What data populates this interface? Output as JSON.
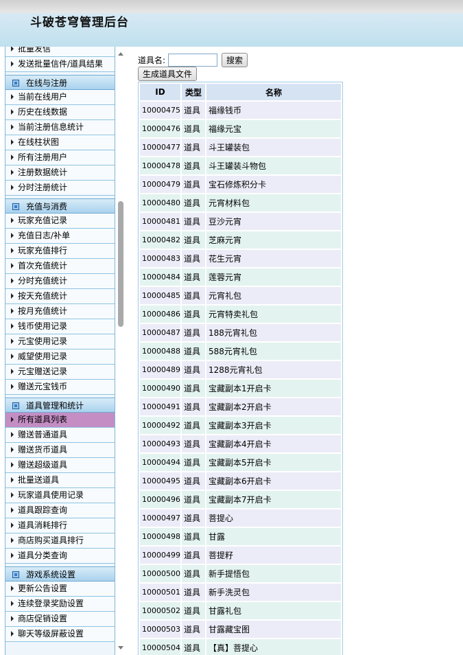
{
  "header": {
    "title": "斗破苍穹管理后台"
  },
  "sidebar": {
    "groups": [
      {
        "title": "",
        "items": [
          "批量发信",
          "发送批量信件/道具结果"
        ]
      },
      {
        "title": "在线与注册",
        "items": [
          "当前在线用户",
          "历史在线数据",
          "当前注册信息统计",
          "在线柱状图",
          "所有注册用户",
          "注册数据统计",
          "分时注册统计"
        ]
      },
      {
        "title": "充值与消费",
        "items": [
          "玩家充值记录",
          "充值日志/补单",
          "玩家充值排行",
          "首次充值统计",
          "分时充值统计",
          "按天充值统计",
          "按月充值统计",
          "钱币使用记录",
          "元宝使用记录",
          "威望使用记录",
          "元宝赠送记录",
          "赠送元宝钱币"
        ]
      },
      {
        "title": "道具管理和统计",
        "items": [
          "所有道具列表",
          "赠送普通道具",
          "赠送货币道具",
          "赠送超级道具",
          "批量送道具",
          "玩家道具使用记录",
          "道具跟踪查询",
          "道具消耗排行",
          "商店购买道具排行",
          "道具分类查询"
        ]
      },
      {
        "title": "游戏系统设置",
        "items": [
          "更新公告设置",
          "连续登录奖励设置",
          "商店促销设置",
          "聊天等级屏蔽设置"
        ]
      }
    ],
    "active_item": "所有道具列表"
  },
  "search": {
    "label": "道具名:",
    "value": "",
    "button": "搜索",
    "generate_button": "生成道具文件"
  },
  "table": {
    "columns": [
      "ID",
      "类型",
      "名称"
    ],
    "rows": [
      [
        "10000475",
        "道具",
        "福缘钱币"
      ],
      [
        "10000476",
        "道具",
        "福缘元宝"
      ],
      [
        "10000477",
        "道具",
        "斗王罐装包"
      ],
      [
        "10000478",
        "道具",
        "斗王罐装斗物包"
      ],
      [
        "10000479",
        "道具",
        "宝石修炼积分卡"
      ],
      [
        "10000480",
        "道具",
        "元宵材料包"
      ],
      [
        "10000481",
        "道具",
        "豆沙元宵"
      ],
      [
        "10000482",
        "道具",
        "芝麻元宵"
      ],
      [
        "10000483",
        "道具",
        "花生元宵"
      ],
      [
        "10000484",
        "道具",
        "莲蓉元宵"
      ],
      [
        "10000485",
        "道具",
        "元宵礼包"
      ],
      [
        "10000486",
        "道具",
        "元宵特卖礼包"
      ],
      [
        "10000487",
        "道具",
        "188元宵礼包"
      ],
      [
        "10000488",
        "道具",
        "588元宵礼包"
      ],
      [
        "10000489",
        "道具",
        "1288元宵礼包"
      ],
      [
        "10000490",
        "道具",
        "宝藏副本1开启卡"
      ],
      [
        "10000491",
        "道具",
        "宝藏副本2开启卡"
      ],
      [
        "10000492",
        "道具",
        "宝藏副本3开启卡"
      ],
      [
        "10000493",
        "道具",
        "宝藏副本4开启卡"
      ],
      [
        "10000494",
        "道具",
        "宝藏副本5开启卡"
      ],
      [
        "10000495",
        "道具",
        "宝藏副本6开启卡"
      ],
      [
        "10000496",
        "道具",
        "宝藏副本7开启卡"
      ],
      [
        "10000497",
        "道具",
        "菩提心"
      ],
      [
        "10000498",
        "道具",
        "甘露"
      ],
      [
        "10000499",
        "道具",
        "菩提籽"
      ],
      [
        "10000500",
        "道具",
        "新手提悟包"
      ],
      [
        "10000501",
        "道具",
        "新手洗灵包"
      ],
      [
        "10000502",
        "道具",
        "甘露礼包"
      ],
      [
        "10000503",
        "道具",
        "甘露藏宝图"
      ],
      [
        "10000504",
        "道具",
        "【真】菩提心"
      ]
    ]
  }
}
